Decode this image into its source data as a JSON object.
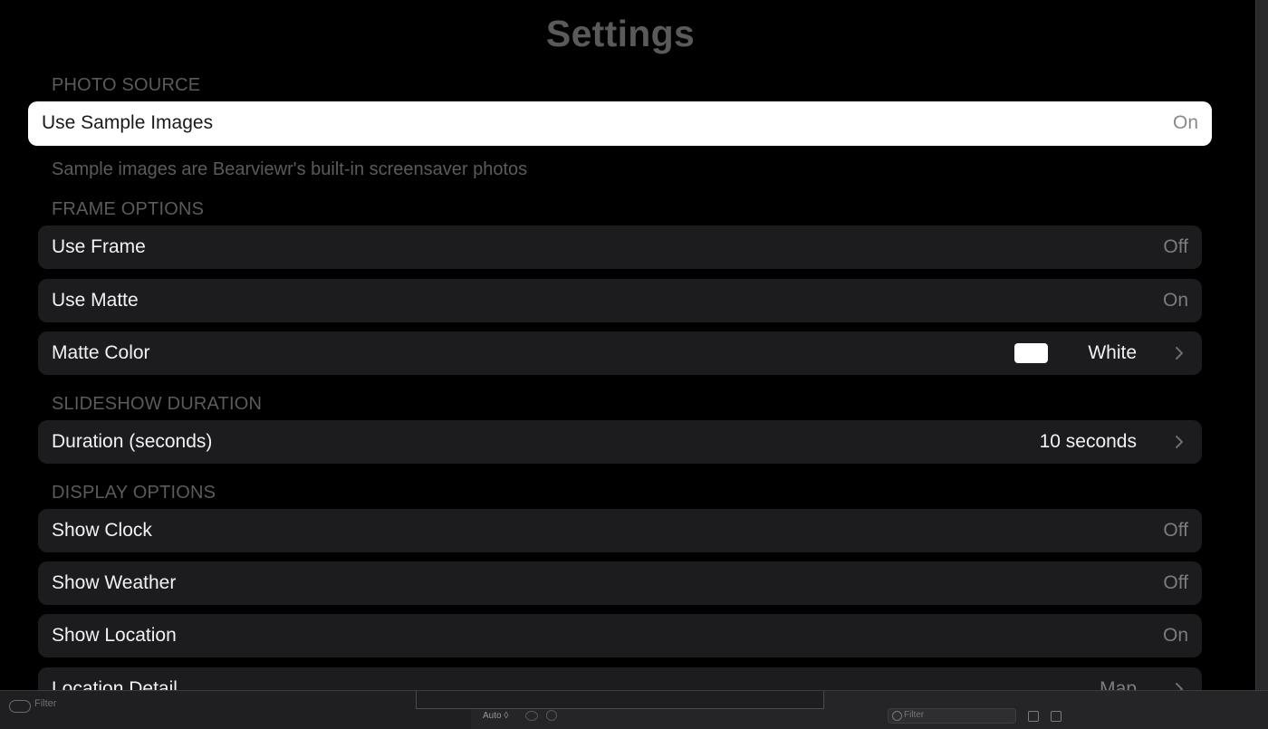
{
  "page": {
    "title": "Settings"
  },
  "sections": {
    "photo_source": {
      "header": "PHOTO SOURCE",
      "rows": [
        {
          "label": "Use Sample Images",
          "value": "On"
        }
      ],
      "footer": "Sample images are Bearviewr's built-in screensaver photos"
    },
    "frame_options": {
      "header": "FRAME OPTIONS",
      "rows": [
        {
          "label": "Use Frame",
          "value": "Off"
        },
        {
          "label": "Use Matte",
          "value": "On"
        },
        {
          "label": "Matte Color",
          "value": "White",
          "swatch_color": "#ffffff",
          "icon": "chevron-right-icon"
        }
      ]
    },
    "slideshow_duration": {
      "header": "SLIDESHOW DURATION",
      "rows": [
        {
          "label": "Duration (seconds)",
          "value": "10 seconds",
          "icon": "chevron-right-icon"
        }
      ]
    },
    "display_options": {
      "header": "DISPLAY OPTIONS",
      "rows": [
        {
          "label": "Show Clock",
          "value": "Off"
        },
        {
          "label": "Show Weather",
          "value": "Off"
        },
        {
          "label": "Show Location",
          "value": "On"
        },
        {
          "label": "Location Detail",
          "value": "Map",
          "icon": "chevron-right-icon"
        }
      ]
    }
  },
  "bottom_bar": {
    "left_filter_placeholder": "Filter",
    "scheme_label": "Auto ◊",
    "right_filter_placeholder": "Filter"
  },
  "colors": {
    "background": "#000000",
    "row_background": "#1c1c1e",
    "focused_row_background": "#ffffff",
    "header_text": "#5b5b5e",
    "value_text": "#7c7c80"
  }
}
